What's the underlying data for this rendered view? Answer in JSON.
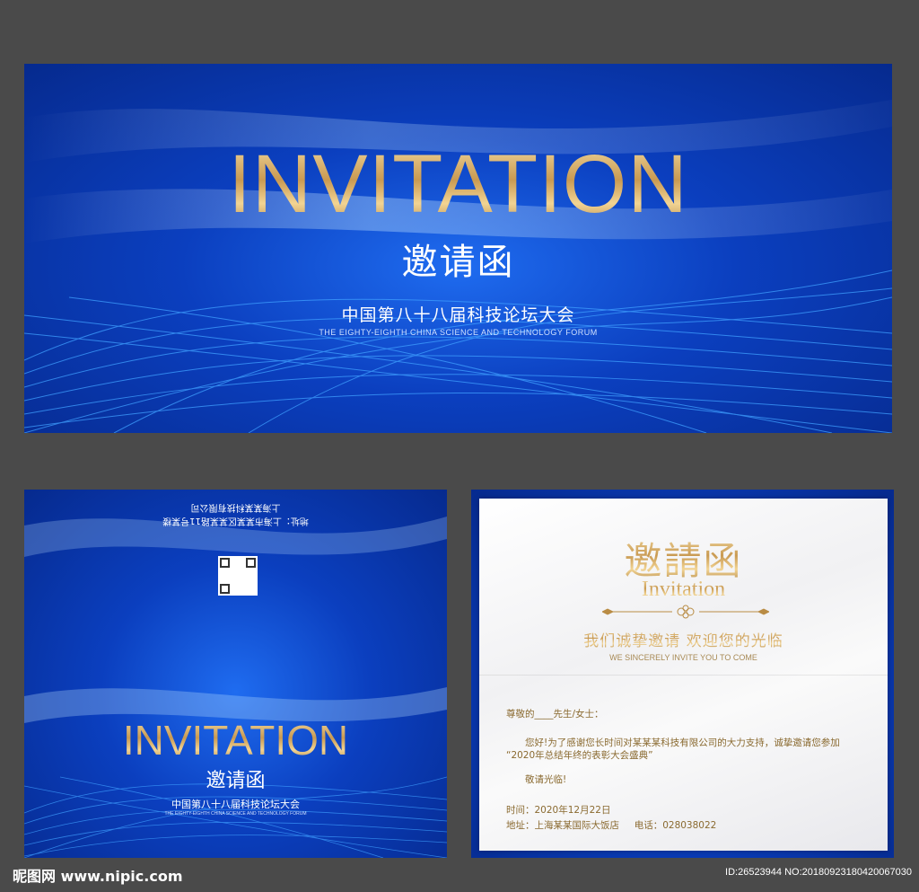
{
  "top_card": {
    "title_en": "INVITATION",
    "title_cn": "邀请函",
    "forum_cn": "中国第八十八届科技论坛大会",
    "forum_en": "THE EIGHTY-EIGHTH CHINA SCIENCE AND TECHNOLOGY FORUM"
  },
  "back_card": {
    "address_line": "地址：上海市某某区某某路11号某楼",
    "company_line": "上海某某科技有限公司",
    "title_en": "INVITATION",
    "title_cn": "邀请函",
    "forum_cn": "中国第八十八届科技论坛大会",
    "forum_en": "THE EIGHTY-EIGHTH CHINA SCIENCE AND TECHNOLOGY FORUM"
  },
  "inner_card": {
    "title_cn": "邀請函",
    "title_en": "Invitation",
    "welcome_cn": "我们诚挚邀请 欢迎您的光临",
    "welcome_en": "WE SINCERELY INVITE YOU TO COME",
    "greeting": "尊敬的____先生/女士：",
    "body_line1": "您好!为了感谢您长时间对某某某科技有限公司的大力支持，诚挚邀请您参加",
    "body_line2": "“2020年总结年终的表彰大会盛典”",
    "closing": "敬请光临!",
    "time": "时间：2020年12月22日",
    "address": "地址：上海某某国际大饭店",
    "phone": "电话：028038022"
  },
  "footer": {
    "logo": "昵图网 www.nipic.com",
    "id": "ID:26523944 NO:20180923180420067030"
  }
}
